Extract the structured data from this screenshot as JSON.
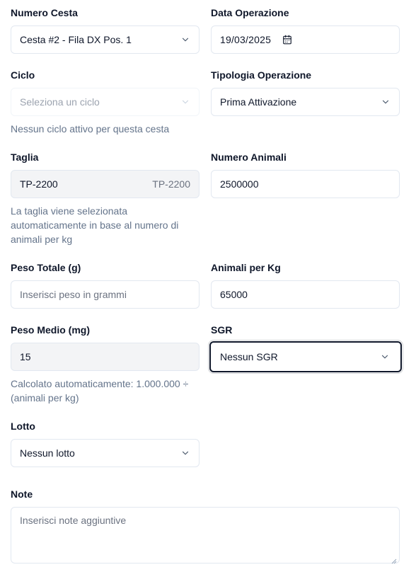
{
  "numero_cesta": {
    "label": "Numero Cesta",
    "value": "Cesta #2 - Fila DX Pos. 1",
    "icon": "chevron-down-icon"
  },
  "data_operazione": {
    "label": "Data Operazione",
    "value": "19/03/2025",
    "icon": "calendar-icon"
  },
  "ciclo": {
    "label": "Ciclo",
    "placeholder": "Seleziona un ciclo",
    "help": "Nessun ciclo attivo per questa cesta",
    "icon": "chevron-down-icon"
  },
  "tipologia_operazione": {
    "label": "Tipologia Operazione",
    "value": "Prima Attivazione",
    "icon": "chevron-down-icon"
  },
  "taglia": {
    "label": "Taglia",
    "value": "TP-2200",
    "badge": "TP-2200",
    "help_lines": [
      "La taglia viene selezionata",
      "automaticamente in base al numero di",
      "animali per kg"
    ]
  },
  "numero_animali": {
    "label": "Numero Animali",
    "value": "2500000"
  },
  "peso_totale": {
    "label": "Peso Totale (g)",
    "placeholder": "Inserisci peso in grammi"
  },
  "animali_per_kg": {
    "label": "Animali per Kg",
    "value": "65000"
  },
  "peso_medio": {
    "label": "Peso Medio (mg)",
    "value": "15",
    "help_lines": [
      "Calcolato automaticamente: 1.000.000 ÷",
      "(animali per kg)"
    ]
  },
  "sgr": {
    "label": "SGR",
    "value": "Nessun SGR",
    "icon": "chevron-down-icon"
  },
  "lotto": {
    "label": "Lotto",
    "value": "Nessun lotto",
    "icon": "chevron-down-icon"
  },
  "note": {
    "label": "Note",
    "placeholder": "Inserisci note aggiuntive"
  },
  "colors": {
    "border": "#e2e8f0",
    "muted_bg": "#f3f4f6",
    "focus_ring": "#0f172a",
    "help_text": "#64748b"
  }
}
